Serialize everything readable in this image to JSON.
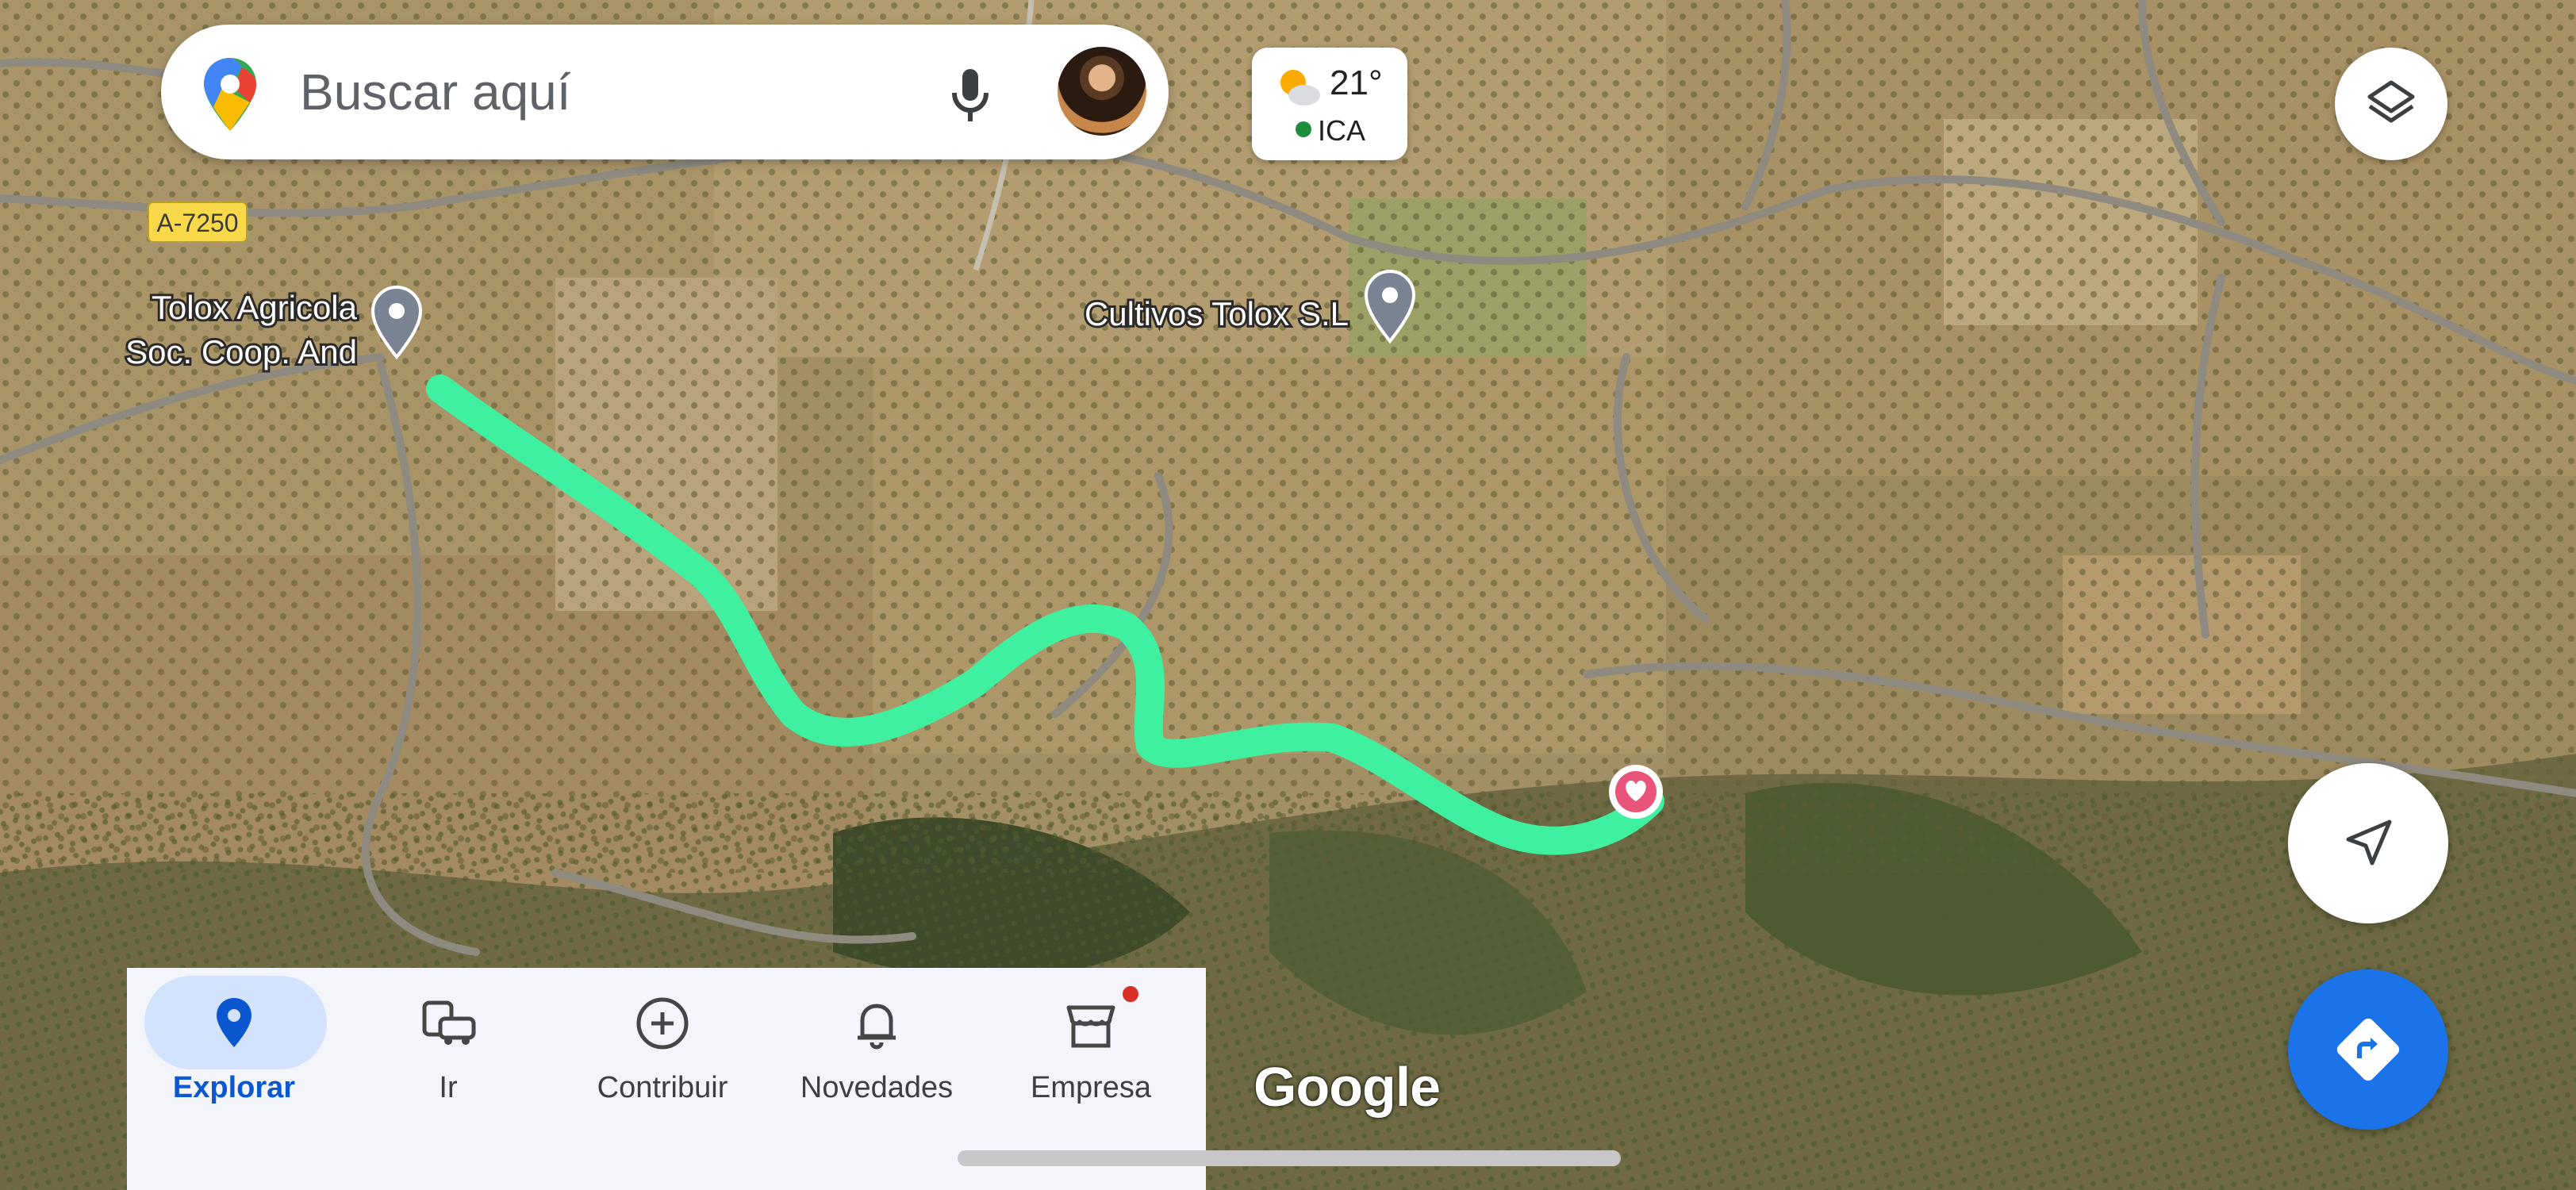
{
  "search": {
    "placeholder": "Buscar aquí"
  },
  "weather": {
    "temperature": "21°",
    "aqi_label": "ICA"
  },
  "map": {
    "road_label": "A-7250",
    "places": [
      {
        "name_line1": "Tolox Agricola",
        "name_line2": "Soc. Coop. And"
      },
      {
        "name": "Cultivos Tolox S.L"
      }
    ],
    "route_color": "#3ff0a0",
    "watermark": "Google"
  },
  "bottom_nav": {
    "tabs": [
      {
        "label": "Explorar",
        "icon": "location-pin-icon",
        "active": true
      },
      {
        "label": "Ir",
        "icon": "commute-icon"
      },
      {
        "label": "Contribuir",
        "icon": "add-circle-icon"
      },
      {
        "label": "Novedades",
        "icon": "bell-icon"
      },
      {
        "label": "Empresa",
        "icon": "storefront-icon",
        "badge": true
      }
    ]
  },
  "buttons": {
    "layers": "layers-icon",
    "locate": "navigation-arrow-icon",
    "directions": "directions-icon"
  }
}
